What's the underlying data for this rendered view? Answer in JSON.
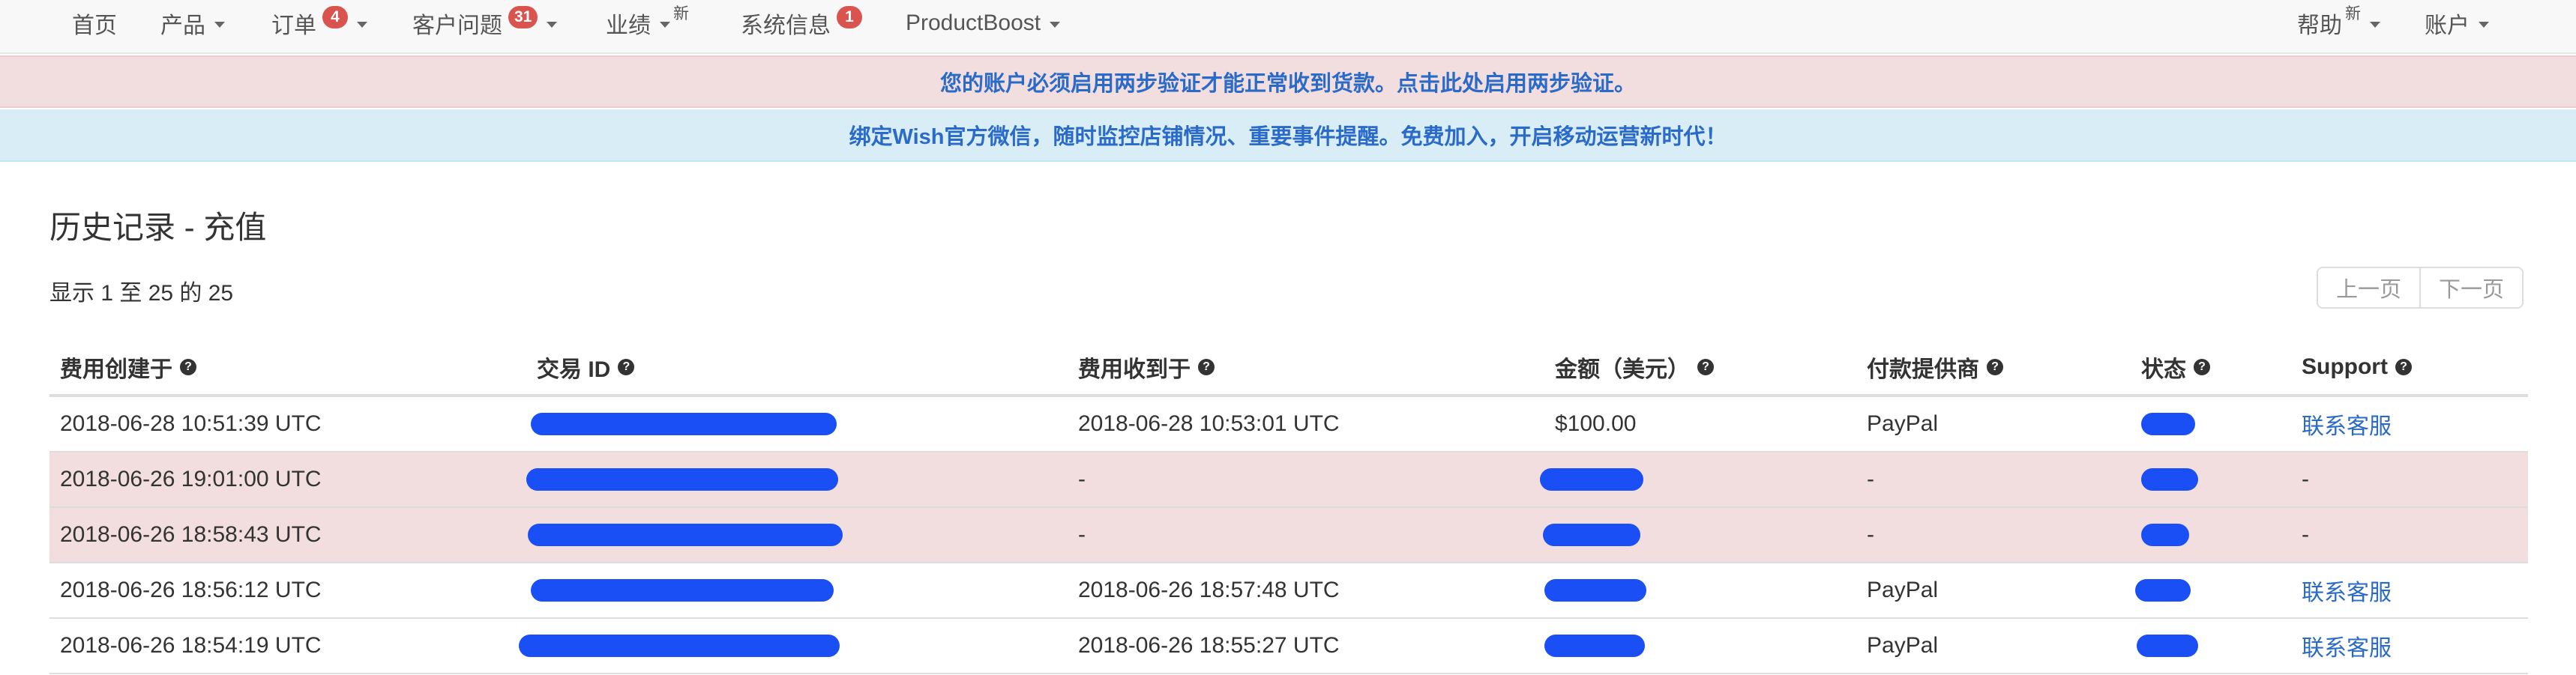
{
  "navbar": {
    "home": "首页",
    "products": "产品",
    "orders": "订单",
    "orders_badge": "4",
    "customer_issues": "客户问题",
    "customer_issues_badge": "31",
    "performance": "业绩",
    "performance_new": "新",
    "system_info": "系统信息",
    "system_info_badge": "1",
    "product_boost": "ProductBoost",
    "help": "帮助",
    "help_new": "新",
    "account": "账户"
  },
  "alerts": {
    "two_factor": "您的账户必须启用两步验证才能正常收到货款。点击此处启用两步验证。",
    "wechat": "绑定Wish官方微信，随时监控店铺情况、重要事件提醒。免费加入，开启移动运营新时代！"
  },
  "page": {
    "title": "历史记录 - 充值",
    "count_text": "显示 1 至 25 的 25",
    "prev_label": "上一页",
    "next_label": "下一页"
  },
  "table": {
    "headers": [
      "费用创建于",
      "交易 ID",
      "费用收到于",
      "金额（美元）",
      "付款提供商",
      "状态",
      "Support"
    ],
    "rows": [
      {
        "created": "2018-06-28 10:51:39 UTC",
        "received": "2018-06-28 10:53:01 UTC",
        "amount": "$100.00",
        "provider": "PayPal",
        "support": "联系客服",
        "highlight": false
      },
      {
        "created": "2018-06-26 19:01:00 UTC",
        "received": "-",
        "amount": "",
        "provider": "-",
        "support": "-",
        "highlight": true
      },
      {
        "created": "2018-06-26 18:58:43 UTC",
        "received": "-",
        "amount": "",
        "provider": "-",
        "support": "-",
        "highlight": true
      },
      {
        "created": "2018-06-26 18:56:12 UTC",
        "received": "2018-06-26 18:57:48 UTC",
        "amount": "",
        "provider": "PayPal",
        "support": "联系客服",
        "highlight": false
      },
      {
        "created": "2018-06-26 18:54:19 UTC",
        "received": "2018-06-26 18:55:27 UTC",
        "amount": "",
        "provider": "PayPal",
        "support": "联系客服",
        "highlight": false
      }
    ]
  },
  "colors": {
    "link": "#2a6ac8",
    "badge": "#d9534f",
    "danger_row": "#f2dede",
    "info_bg": "#d9edf7",
    "redaction": "#1a4ff5"
  }
}
